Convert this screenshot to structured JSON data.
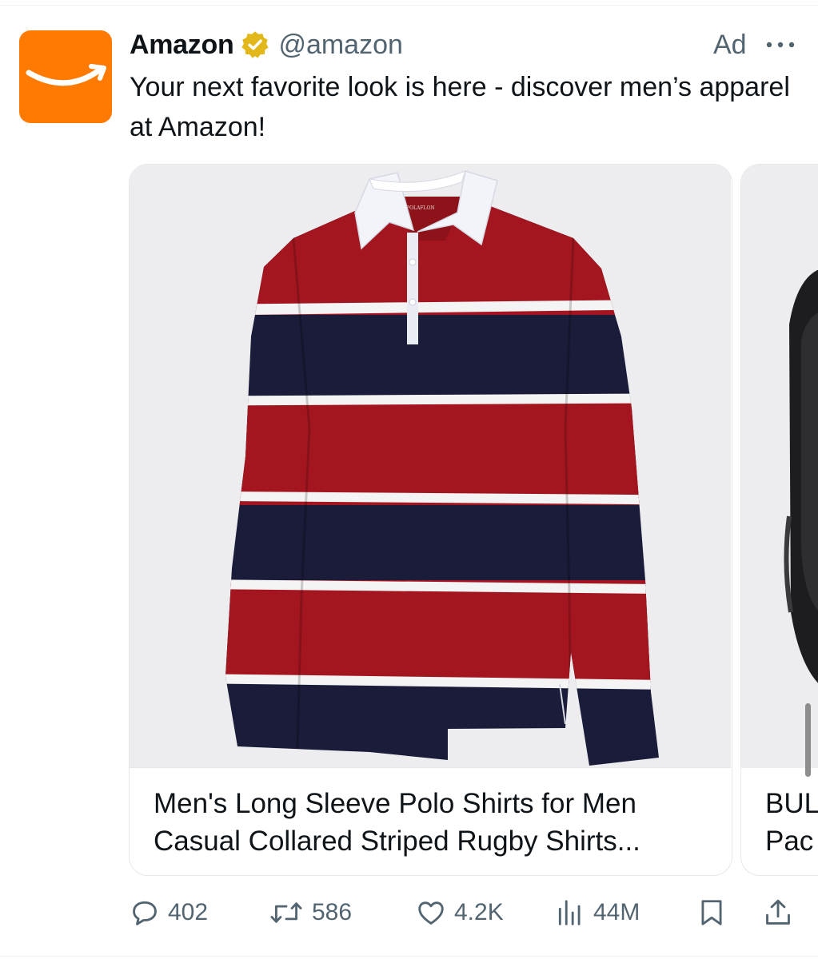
{
  "tweet": {
    "author_name": "Amazon",
    "author_handle": "@amazon",
    "ad_label": "Ad",
    "text": "Your next favorite look is here - discover men’s apparel at Amazon!"
  },
  "carousel": [
    {
      "title": "Men's Long Sleeve Polo Shirts for Men Casual Collared Striped Rugby Shirts..."
    },
    {
      "title": "BUL\nPac"
    }
  ],
  "product_image": {
    "label_text": "PPOLAFLON"
  },
  "actions": {
    "replies": "402",
    "reposts": "586",
    "likes": "4.2K",
    "views": "44M"
  },
  "colors": {
    "brand_orange": "#ff7a00",
    "verified_gold": "#e2b719",
    "secondary_text": "#536471",
    "shirt_red": "#a4161f",
    "shirt_navy": "#1a1c39"
  }
}
